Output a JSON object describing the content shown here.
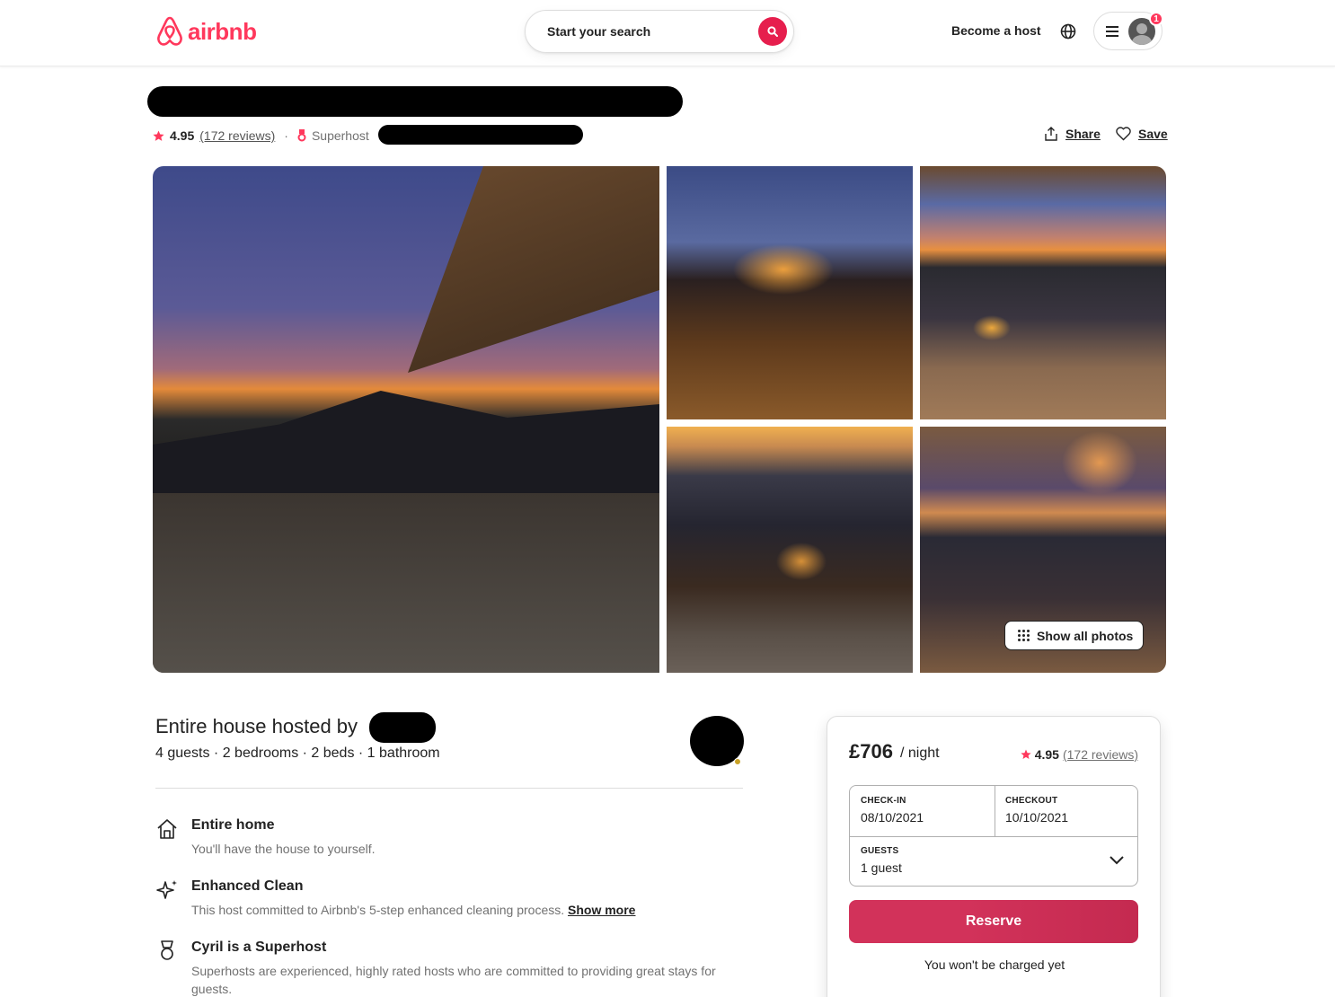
{
  "header": {
    "logo_text": "airbnb",
    "search_placeholder": "Start your search",
    "become_host": "Become a host",
    "notification_count": "1"
  },
  "listing": {
    "rating": "4.95",
    "reviews": "(172 reviews)",
    "superhost_label": "Superhost",
    "share_label": "Share",
    "save_label": "Save",
    "show_all_photos": "Show all photos",
    "host_title": "Entire house hosted by",
    "host_details": "4 guests · 2 bedrooms · 2 beds · 1 bathroom",
    "features": [
      {
        "icon": "home-icon",
        "title": "Entire home",
        "desc": "You'll have the house to yourself."
      },
      {
        "icon": "sparkle-icon",
        "title": "Enhanced Clean",
        "desc": "This host committed to Airbnb's 5-step enhanced cleaning process.",
        "link": "Show more"
      },
      {
        "icon": "medal-icon",
        "title": "Cyril is a Superhost",
        "desc": "Superhosts are experienced, highly rated hosts who are committed to providing great stays for guests."
      }
    ]
  },
  "booking": {
    "price": "£706",
    "per_night": "/ night",
    "rating": "4.95",
    "reviews": "(172 reviews)",
    "checkin_label": "CHECK-IN",
    "checkin_value": "08/10/2021",
    "checkout_label": "CHECKOUT",
    "checkout_value": "10/10/2021",
    "guests_label": "GUESTS",
    "guests_value": "1 guest",
    "reserve_label": "Reserve",
    "not_charged": "You won't be charged yet"
  },
  "colors": {
    "brand": "#ff385c",
    "reserve": "#d2325a",
    "text": "#222222",
    "muted": "#717171"
  }
}
